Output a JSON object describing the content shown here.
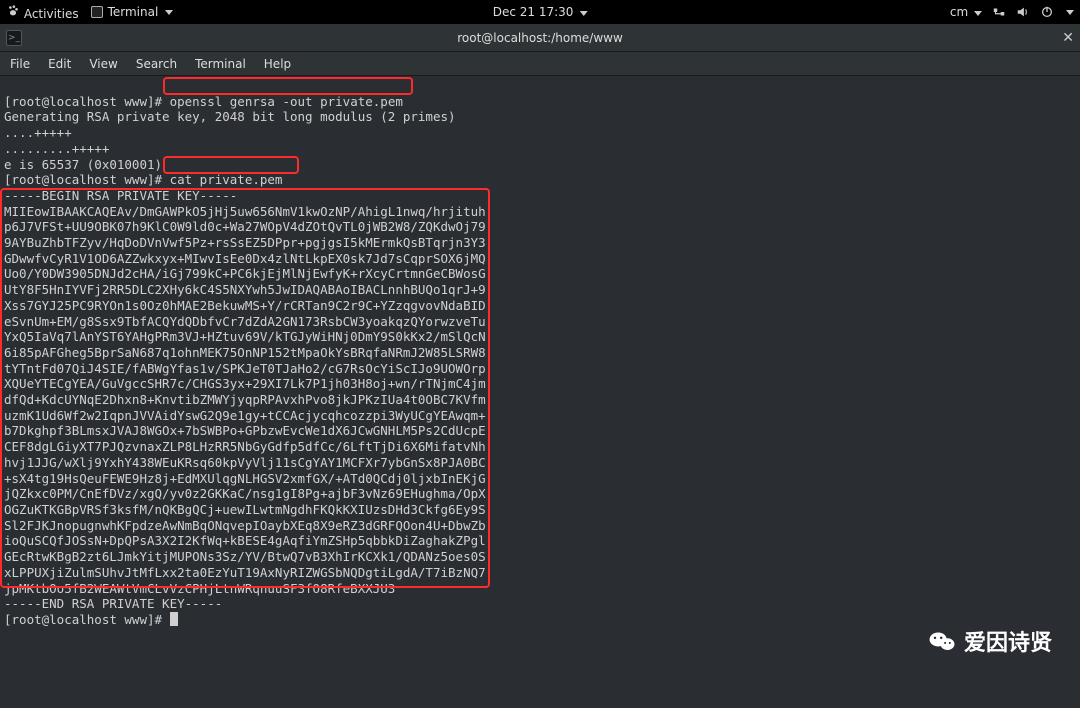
{
  "topbar": {
    "activities": "Activities",
    "app_label": "Terminal",
    "datetime": "Dec 21  17:30",
    "user": "cm"
  },
  "titlebar": {
    "title": "root@localhost:/home/www"
  },
  "menubar": {
    "file": "File",
    "edit": "Edit",
    "view": "View",
    "search": "Search",
    "terminal": "Terminal",
    "help": "Help"
  },
  "term": {
    "prompt1": "[root@localhost www]# ",
    "cmd1": "openssl genrsa -out private.pem",
    "gen_line": "Generating RSA private key, 2048 bit long modulus (2 primes)",
    "dots1": "....+++++",
    "dots2": ".........+++++",
    "e_line": "e is 65537 (0x010001)",
    "prompt2": "[root@localhost www]# ",
    "cmd2": "cat private.pem",
    "begin": "-----BEGIN RSA PRIVATE KEY-----",
    "key_lines": [
      "MIIEowIBAAKCAQEAv/DmGAWPkO5jHj5uw656NmV1kwOzNP/AhigL1nwq/hrjituh",
      "p6J7VFSt+UU9OBK07h9KlC0W9ld0c+Wa27WOpV4dZOtQvTL0jWB2W8/ZQKdwOj79",
      "9AYBuZhbTFZyv/HqDoDVnVwf5Pz+rsSsEZ5DPpr+pgjgsI5kMErmkQsBTqrjn3Y3",
      "GDwwfvCyR1V1OD6AZZwkxyx+MIwvIsEe0Dx4zlNtLkpEX0sk7Jd7sCqprSOX6jMQ",
      "Uo0/Y0DW3905DNJd2cHA/iGj799kC+PC6kjEjMlNjEwfyK+rXcyCrtmnGeCBWosG",
      "UtY8F5HnIYVFj2RR5DLC2XHy6kC4S5NXYwh5JwIDAQABAoIBACLnnhBUQo1qrJ+9",
      "Xss7GYJ25PC9RYOn1s0Oz0hMAE2BekuwMS+Y/rCRTan9C2r9C+YZzqgvovNdaBID",
      "eSvnUm+EM/g8Ssx9TbfACQYdQDbfvCr7dZdA2GN173RsbCW3yoakqzQYorwzveTu",
      "YxQ5IaVq7lAnYST6YAHgPRm3VJ+HZtuv69V/kTGJyWiHNj0DmY9S0kKx2/mSlQcN",
      "6i85pAFGheg5BprSaN687q1ohnMEK75OnNP152tMpaOkYsBRqfaNRmJ2W85LSRW8",
      "tYTntFd07QiJ4SIE/fABWgYfas1v/SPKJeT0TJaHo2/cG7RsOcYiScIJo9UOWOrp",
      "XQUeYTECgYEA/GuVgccSHR7c/CHGS3yx+29XI7Lk7P1jh03H8oj+wn/rTNjmC4jm",
      "dfQd+KdcUYNqE2Dhxn8+KnvtibZMWYjyqpRPAvxhPvo8jkJPKzIUa4t0OBC7KVfm",
      "uzmK1Ud6Wf2w2IqpnJVVAidYswG2Q9e1gy+tCCAcjycqhcozzpi3WyUCgYEAwqm+",
      "b7Dkghpf3BLmsxJVAJ8WGOx+7bSWBPo+GPbzwEvcWe1dX6JCwGNHLM5Ps2CdUcpE",
      "CEF8dgLGiyXT7PJQzvnaxZLP8LHzRR5NbGyGdfp5dfCc/6LftTjDi6X6MifatvNh",
      "hvj1JJG/wXlj9YxhY438WEuKRsq60kpVyVlj11sCgYAY1MCFXr7ybGnSx8PJA0BC",
      "+sX4tg19HsQeuFEWE9Hz8j+EdMXUlqgNLHGSV2xmfGX/+ATd0QCdj0ljxbInEKjG",
      "jQZkxc0PM/CnEfDVz/xgQ/yv0z2GKKaC/nsg1gI8Pg+ajbF3vNz69EHughma/OpX",
      "OGZuKTKGBpVRSf3ksfM/nQKBgQCj+uewILwtmNgdhFKQkKXIUzsDHd3Ckfg6Ey9S",
      "Sl2FJKJnopugnwhKFpdzeAwNmBqONqvepIOaybXEq8X9eRZ3dGRFQOon4U+DbwZb",
      "ioQuSCQfJOSsN+DpQPsA3X2I2KfWq+kBESE4gAqfiYmZSHp5qbbkDiZaghakZPgl",
      "GEcRtwKBgB2zt6LJmkYitjMUPONs3Sz/YV/BtwQ7vB3XhIrKCXk1/QDANz5oes0S",
      "xLPPUXjiZulmSUhvJtMfLxx2ta0EzYuT19AxNyRIZWGSbNQDgtiLgdA/T7iBzNQ7",
      "jpMKtbOo5fB2WEAWtVmCLvVzCPHjLtnWRqnuuSF3fO8RfeBXXJU3"
    ],
    "end": "-----END RSA PRIVATE KEY-----",
    "prompt3": "[root@localhost www]# "
  },
  "watermark": {
    "text": "爱因诗贤"
  }
}
